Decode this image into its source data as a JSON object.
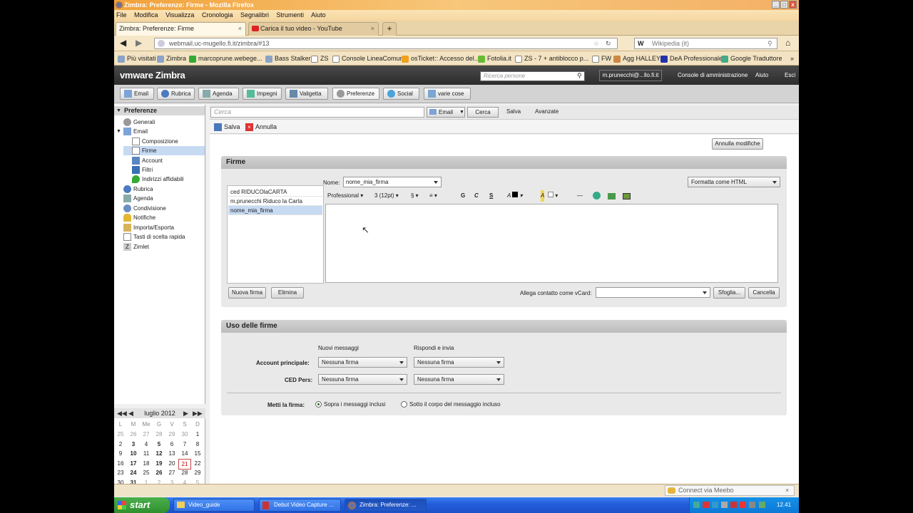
{
  "browser": {
    "title": "Zimbra: Preferenze: Firme - Mozilla Firefox",
    "menu": [
      "File",
      "Modifica",
      "Visualizza",
      "Cronologia",
      "Segnalibri",
      "Strumenti",
      "Aiuto"
    ],
    "tabs": [
      {
        "label": "Zimbra: Preferenze: Firme",
        "active": true
      },
      {
        "label": "Carica il tuo video - YouTube",
        "active": false
      }
    ],
    "url": "webmail.uc-mugello.fi.it/zimbra/#13",
    "search_engine_text": "Wikipedia (it)",
    "bookmarks": [
      "Più visitati",
      "Zimbra",
      "marcoprune.webege...",
      "Bass Stalker",
      "ZS",
      "Console LineaComune",
      "osTicket:: Accesso del...",
      "Fotolia.it",
      "ZS - 7 + antiblocco p...",
      "FW",
      "Agg HALLEY",
      "DeA Professionale",
      "Google Traduttore"
    ],
    "status_right": "Connect via Meebo"
  },
  "zimbra": {
    "logo": "vmware Zimbra",
    "people_search_placeholder": "Ricerca persone",
    "user": "m.prunecchi@...llo.fi.it",
    "header_links": [
      "Console di amministrazione",
      "Aiuto",
      "Esci"
    ],
    "apps": [
      "Email",
      "Rubrica",
      "Agenda",
      "Impegni",
      "Valigetta",
      "Preferenze",
      "Social",
      "varie cose"
    ],
    "sidebar": {
      "header": "Preferenze",
      "items": [
        {
          "label": "Generali",
          "icon": "gear-icon"
        },
        {
          "label": "Email",
          "icon": "mail-icon"
        },
        {
          "label": "Composizione",
          "icon": "compose-icon"
        },
        {
          "label": "Firme",
          "icon": "pen-icon"
        },
        {
          "label": "Account",
          "icon": "account-icon"
        },
        {
          "label": "Filtri",
          "icon": "filter-icon"
        },
        {
          "label": "Indirizzi affidabili",
          "icon": "shield-icon"
        },
        {
          "label": "Rubrica",
          "icon": "contacts-icon"
        },
        {
          "label": "Agenda",
          "icon": "calendar-icon"
        },
        {
          "label": "Condivisione",
          "icon": "share-icon"
        },
        {
          "label": "Notifiche",
          "icon": "bell-icon"
        },
        {
          "label": "Importa/Esporta",
          "icon": "import-icon"
        },
        {
          "label": "Tasti di scelta rapida",
          "icon": "keyboard-icon"
        },
        {
          "label": "Zimlet",
          "icon": "zimlet-icon"
        }
      ]
    },
    "calendar": {
      "month": "luglio 2012",
      "weekdays": [
        "L",
        "M",
        "Me",
        "G",
        "V",
        "S",
        "D"
      ],
      "weeks": [
        [
          "25",
          "26",
          "27",
          "28",
          "29",
          "30",
          "1"
        ],
        [
          "2",
          "3",
          "4",
          "5",
          "6",
          "7",
          "8"
        ],
        [
          "9",
          "10",
          "11",
          "12",
          "13",
          "14",
          "15"
        ],
        [
          "16",
          "17",
          "18",
          "19",
          "20",
          "21",
          "22"
        ],
        [
          "23",
          "24",
          "25",
          "26",
          "27",
          "28",
          "29"
        ],
        [
          "30",
          "31",
          "1",
          "2",
          "3",
          "4",
          "5"
        ]
      ],
      "today": "21"
    },
    "toolbar": {
      "search_placeholder": "Cerca",
      "scope": "Email",
      "search_button": "Cerca",
      "save_search": "Salva",
      "advanced": "Avanzate",
      "save": "Salva",
      "cancel": "Annulla",
      "revert": "Annulla modifiche"
    },
    "firme": {
      "title": "Firme",
      "name_label": "Nome:",
      "name_value": "nome_mia_firma",
      "format": "Formatta come HTML",
      "signatures": [
        "ced RIDUCOlaCARTA",
        "m.prunecchi Riduco la Carta",
        "nome_mia_firma"
      ],
      "font": "Professional",
      "size": "3 (12pt)",
      "new_button": "Nuova firma",
      "delete_button": "Elimina",
      "vcard_label": "Allega contatto come vCard:",
      "browse_button": "Sfoglia...",
      "clear_button": "Cancella"
    },
    "uso": {
      "title": "Uso delle firme",
      "col_new": "Nuovi messaggi",
      "col_reply": "Rispondi e invia",
      "rows": [
        {
          "label": "Account principale:",
          "new": "Nessuna firma",
          "reply": "Nessuna firma"
        },
        {
          "label": "CED Pers:",
          "new": "Nessuna firma",
          "reply": "Nessuna firma"
        }
      ],
      "place_label": "Metti la firma:",
      "option_above": "Sopra i messaggi inclusi",
      "option_below": "Sotto il corpo del messaggio incluso"
    }
  },
  "taskbar": {
    "start": "start",
    "tasks": [
      "Video_guide",
      "Debut Video Capture ...",
      "Zimbra: Preferenze: ..."
    ],
    "clock": "12.41"
  }
}
